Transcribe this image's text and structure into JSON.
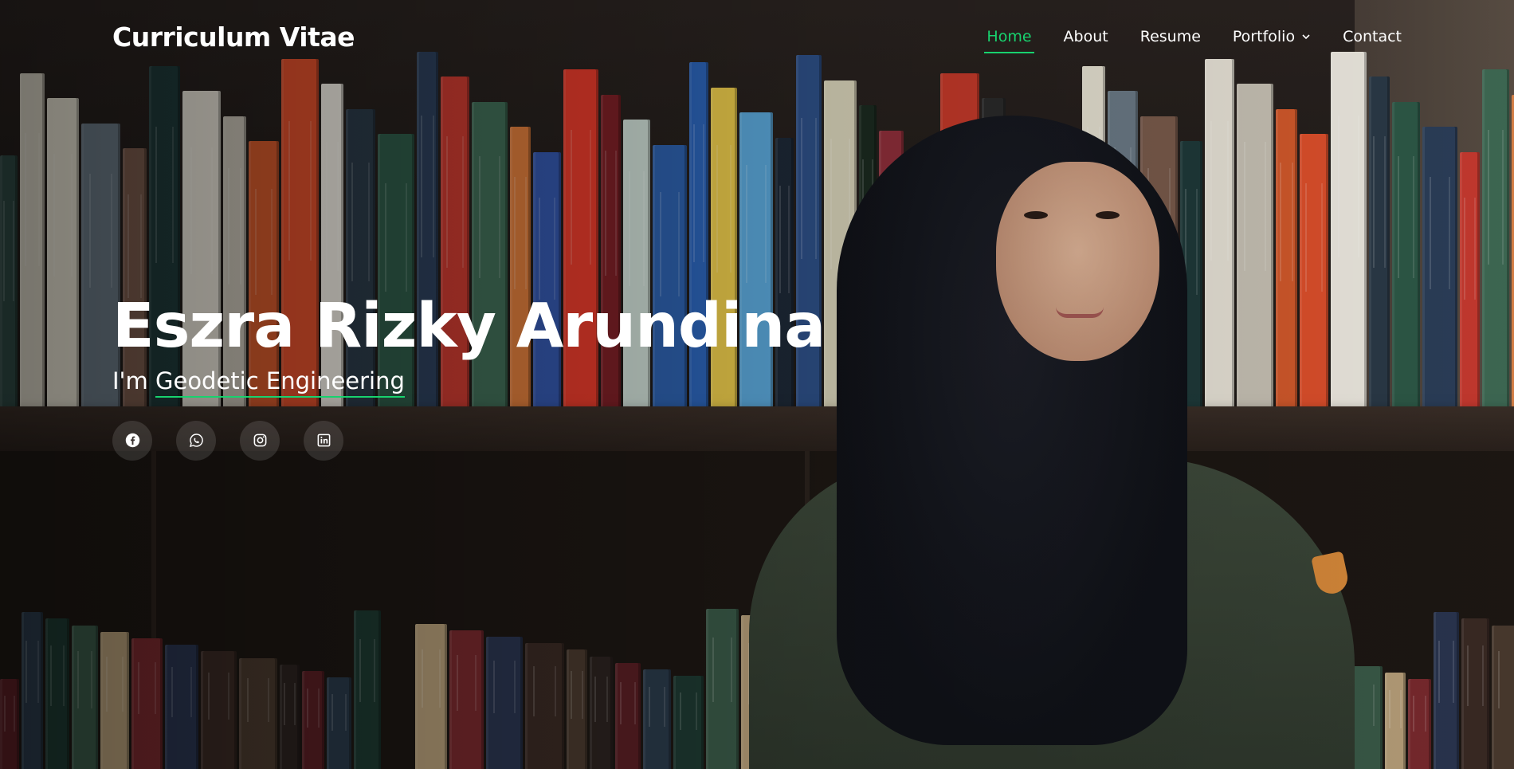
{
  "header": {
    "logo": "Curriculum Vitae",
    "nav": [
      {
        "label": "Home",
        "active": true
      },
      {
        "label": "About"
      },
      {
        "label": "Resume"
      },
      {
        "label": "Portfolio",
        "has_dropdown": true
      },
      {
        "label": "Contact"
      }
    ]
  },
  "hero": {
    "name": "Eszra Rizky Arundina",
    "subtitle_prefix": "I'm ",
    "subtitle_typed": "Geodetic Engineering",
    "socials": [
      {
        "icon": "facebook-icon"
      },
      {
        "icon": "whatsapp-icon"
      },
      {
        "icon": "instagram-icon"
      },
      {
        "icon": "linkedin-icon"
      }
    ]
  },
  "colors": {
    "accent": "#18d26e",
    "text": "#ffffff"
  }
}
